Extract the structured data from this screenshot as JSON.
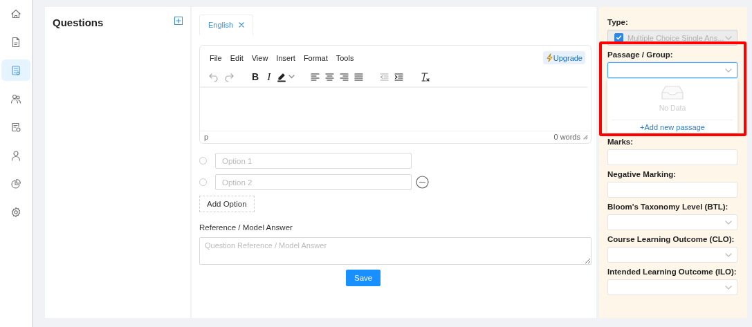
{
  "sidebar": {
    "items": [
      {
        "selected": false
      },
      {
        "selected": false
      },
      {
        "selected": true
      },
      {
        "selected": false
      },
      {
        "selected": false
      },
      {
        "selected": false
      },
      {
        "selected": false
      },
      {
        "selected": false
      }
    ]
  },
  "questions_panel": {
    "title": "Questions"
  },
  "editor": {
    "tabs": [
      {
        "label": "English",
        "selected": true
      }
    ],
    "menu": [
      "File",
      "Edit",
      "View",
      "Insert",
      "Format",
      "Tools"
    ],
    "upgrade": "Upgrade",
    "toolbar": [
      {
        "kind": "undo",
        "disabled": true
      },
      {
        "kind": "redo",
        "disabled": true
      },
      {
        "kind": "bold",
        "label": "B",
        "disabled": false
      },
      {
        "kind": "italic",
        "label": "I",
        "disabled": false
      },
      {
        "kind": "highlight",
        "disabled": false
      },
      {
        "kind": "align_left",
        "disabled": false
      },
      {
        "kind": "align_center",
        "disabled": false
      },
      {
        "kind": "align_right",
        "disabled": false
      },
      {
        "kind": "justify",
        "disabled": false
      },
      {
        "kind": "outdent",
        "disabled": true
      },
      {
        "kind": "indent",
        "disabled": false
      },
      {
        "kind": "clear_format",
        "disabled": false
      }
    ],
    "status_path": "p",
    "word_count": "0 words",
    "options": [
      {
        "placeholder": "Option 1",
        "selected": false,
        "removable": false
      },
      {
        "placeholder": "Option 2",
        "selected": false,
        "removable": true
      }
    ],
    "add_option": "Add Option",
    "reference_label": "Reference / Model Answer",
    "reference_placeholder": "Question Reference / Model Answer",
    "save": "Save"
  },
  "settings": {
    "fields": [
      {
        "label": "Type:",
        "kind": "select",
        "value": "Multiple Choice Single Ans...",
        "disabled": true,
        "expanded": false,
        "highlighted": false
      },
      {
        "label": "Passage / Group:",
        "kind": "select",
        "disabled": false,
        "expanded": true,
        "highlighted": true,
        "dropdown": {
          "empty_text": "No Data",
          "action": "+Add new passage"
        }
      },
      {
        "label": "Marks:",
        "kind": "input",
        "highlighted": false
      },
      {
        "label": "Negative Marking:",
        "kind": "input",
        "highlighted": false
      },
      {
        "label": "Bloom's Taxonomy Level (BTL):",
        "kind": "select",
        "disabled": false,
        "expanded": false,
        "highlighted": false
      },
      {
        "label": "Course Learning Outcome (CLO):",
        "kind": "select",
        "disabled": false,
        "expanded": false,
        "highlighted": false
      },
      {
        "label": "Intended Learning Outcome (ILO):",
        "kind": "select",
        "disabled": false,
        "expanded": false,
        "highlighted": false
      }
    ]
  }
}
